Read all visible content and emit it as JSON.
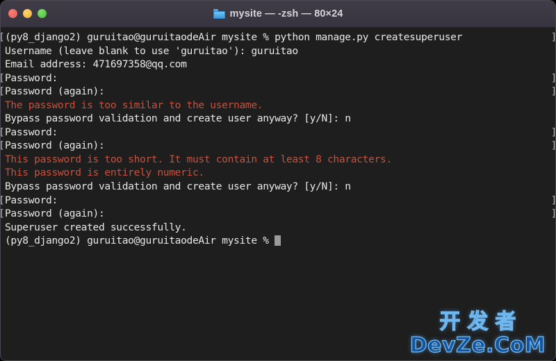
{
  "window": {
    "title": "mysite — -zsh — 80×24",
    "folder_icon": "folder-icon",
    "traffic_lights": [
      {
        "name": "close-button",
        "color": "#e0625c"
      },
      {
        "name": "minimize-button",
        "color": "#e8b13c"
      },
      {
        "name": "maximize-button",
        "color": "#4cbb3a"
      }
    ],
    "colors": {
      "titlebar_bg": "#3a3740",
      "terminal_bg": "#1e1e1e",
      "text": "#e8e8e8",
      "error_text": "#c8503c",
      "cursor": "#9b9b9b",
      "accent_blue": "#3d9ade"
    }
  },
  "terminal": {
    "shell": "-zsh",
    "size": "80×24",
    "lines": [
      {
        "text": "(py8_django2) guruitao@guruitaodeAir mysite % python manage.py createsuperuser",
        "type": "prompt",
        "bracket": true
      },
      {
        "text": "Username (leave blank to use 'guruitao'): guruitao",
        "type": "output",
        "bracket": false
      },
      {
        "text": "Email address: 471697358@qq.com",
        "type": "output",
        "bracket": false
      },
      {
        "text": "Password:",
        "type": "output",
        "bracket": true
      },
      {
        "text": "Password (again):",
        "type": "output",
        "bracket": true
      },
      {
        "text": "The password is too similar to the username.",
        "type": "error",
        "bracket": false
      },
      {
        "text": "Bypass password validation and create user anyway? [y/N]: n",
        "type": "output",
        "bracket": false
      },
      {
        "text": "Password:",
        "type": "output",
        "bracket": true
      },
      {
        "text": "Password (again):",
        "type": "output",
        "bracket": true
      },
      {
        "text": "This password is too short. It must contain at least 8 characters.",
        "type": "error",
        "bracket": false
      },
      {
        "text": "This password is entirely numeric.",
        "type": "error",
        "bracket": false
      },
      {
        "text": "Bypass password validation and create user anyway? [y/N]: n",
        "type": "output",
        "bracket": false
      },
      {
        "text": "Password:",
        "type": "output",
        "bracket": true
      },
      {
        "text": "Password (again):",
        "type": "output",
        "bracket": true
      },
      {
        "text": "Superuser created successfully.",
        "type": "output",
        "bracket": false
      },
      {
        "text": "(py8_django2) guruitao@guruitaodeAir mysite % ",
        "type": "prompt",
        "bracket": false,
        "cursor": true
      }
    ]
  },
  "watermark": {
    "cn": "开发者",
    "en": "DevZe.CoM"
  }
}
